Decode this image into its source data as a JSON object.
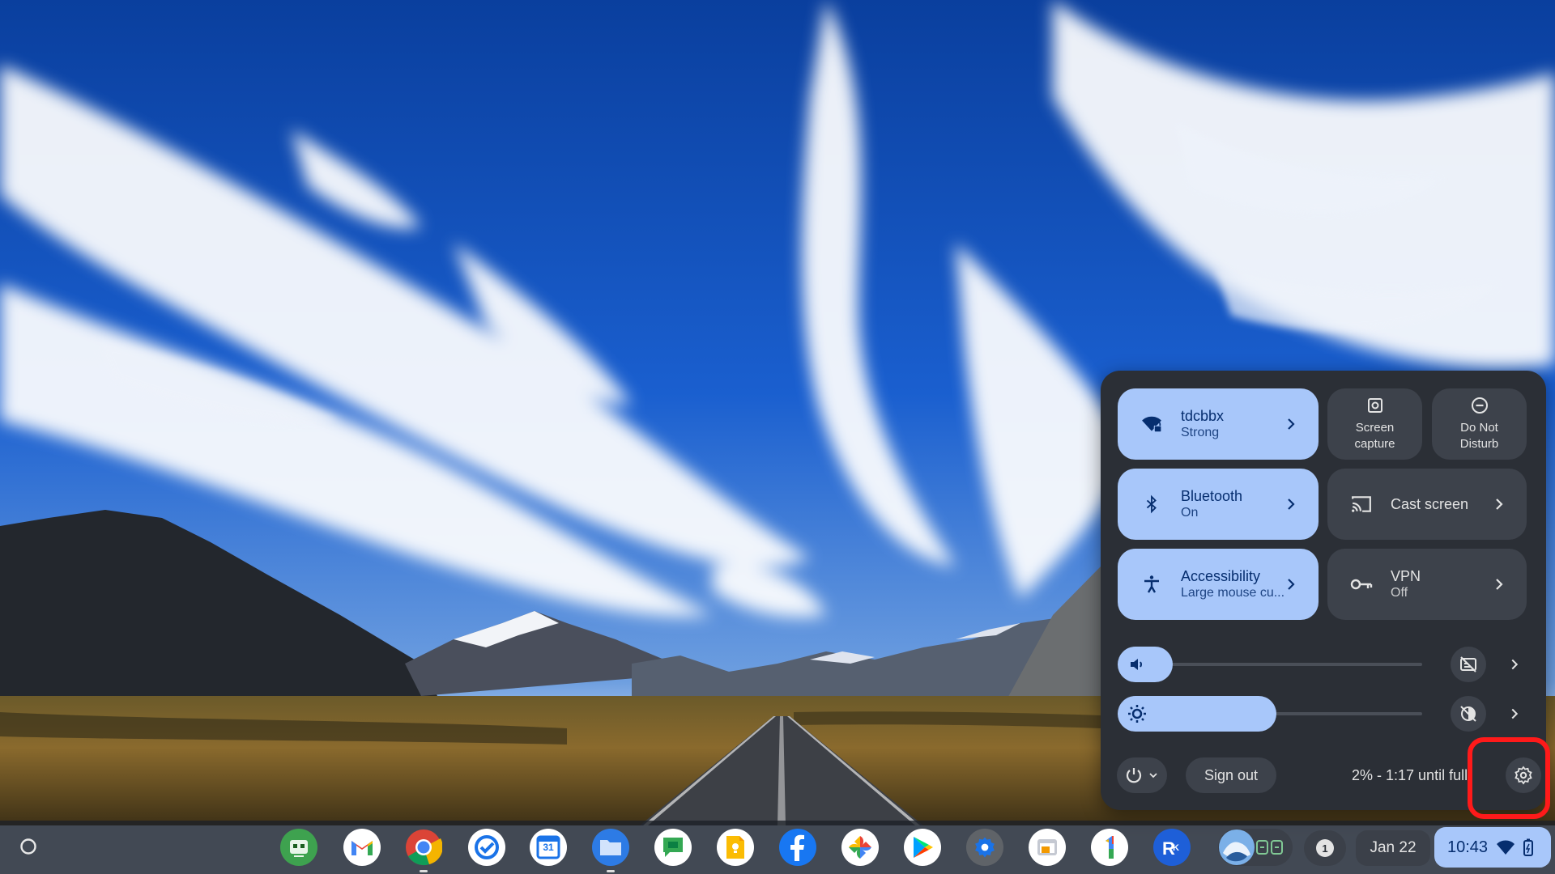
{
  "quick_settings": {
    "network": {
      "name": "tdcbbx",
      "status": "Strong"
    },
    "screen_capture": {
      "line1": "Screen",
      "line2": "capture"
    },
    "do_not_disturb": {
      "line1": "Do Not",
      "line2": "Disturb"
    },
    "bluetooth": {
      "name": "Bluetooth",
      "status": "On"
    },
    "cast": {
      "label": "Cast screen"
    },
    "accessibility": {
      "name": "Accessibility",
      "status": "Large mouse cu..."
    },
    "vpn": {
      "name": "VPN",
      "status": "Off"
    },
    "volume_level": 0.18,
    "brightness_level": 0.52,
    "sign_out_label": "Sign out",
    "battery_status": "2% - 1:17 until full"
  },
  "shelf": {
    "apps": [
      "text-editor",
      "gmail",
      "chrome",
      "tasks",
      "calendar",
      "files",
      "chat",
      "keep",
      "facebook",
      "photos",
      "play-store",
      "settings",
      "app-window",
      "google-one",
      "app-rk"
    ],
    "calendar_badge": "31",
    "notification_count": "1",
    "date": "Jan 22",
    "time": "10:43"
  },
  "colors": {
    "accent": "#a8c7fa",
    "panel": "#2b2f36",
    "tile_off": "#3d424b",
    "highlight": "#ff1a1a"
  }
}
